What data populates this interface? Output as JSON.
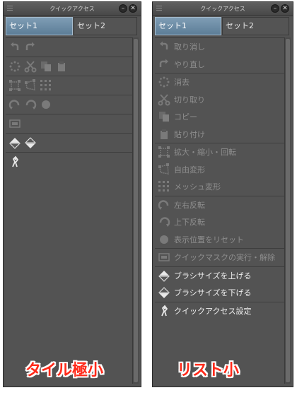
{
  "panel_title": "クイックアクセス",
  "tabs": [
    "セット1",
    "セット2"
  ],
  "left_panel": {
    "caption": "タイル極小"
  },
  "right_panel": {
    "caption": "リスト小",
    "items": [
      {
        "label": "取り消し",
        "icon": "undo-icon"
      },
      {
        "label": "やり直し",
        "icon": "redo-icon"
      },
      {
        "label": "消去",
        "icon": "clear-icon"
      },
      {
        "label": "切り取り",
        "icon": "cut-icon"
      },
      {
        "label": "コピー",
        "icon": "copy-icon"
      },
      {
        "label": "貼り付け",
        "icon": "paste-icon"
      },
      {
        "label": "拡大・縮小・回転",
        "icon": "scale-rotate-icon"
      },
      {
        "label": "自由変形",
        "icon": "free-transform-icon"
      },
      {
        "label": "メッシュ変形",
        "icon": "mesh-transform-icon"
      },
      {
        "label": "左右反転",
        "icon": "flip-horizontal-icon"
      },
      {
        "label": "上下反転",
        "icon": "flip-vertical-icon"
      },
      {
        "label": "表示位置をリセット",
        "icon": "reset-view-icon"
      },
      {
        "label": "クイックマスクの実行・解除",
        "icon": "quick-mask-icon"
      },
      {
        "label": "ブラシサイズを上げる",
        "icon": "brush-size-up-icon"
      },
      {
        "label": "ブラシサイズを下げる",
        "icon": "brush-size-down-icon"
      },
      {
        "label": "クイックアクセス設定",
        "icon": "quick-access-settings-icon"
      }
    ]
  },
  "colors": {
    "accent_tab": "#6f8ea8",
    "panel_bg": "#535353",
    "caption_red": "#ff2a1a"
  }
}
